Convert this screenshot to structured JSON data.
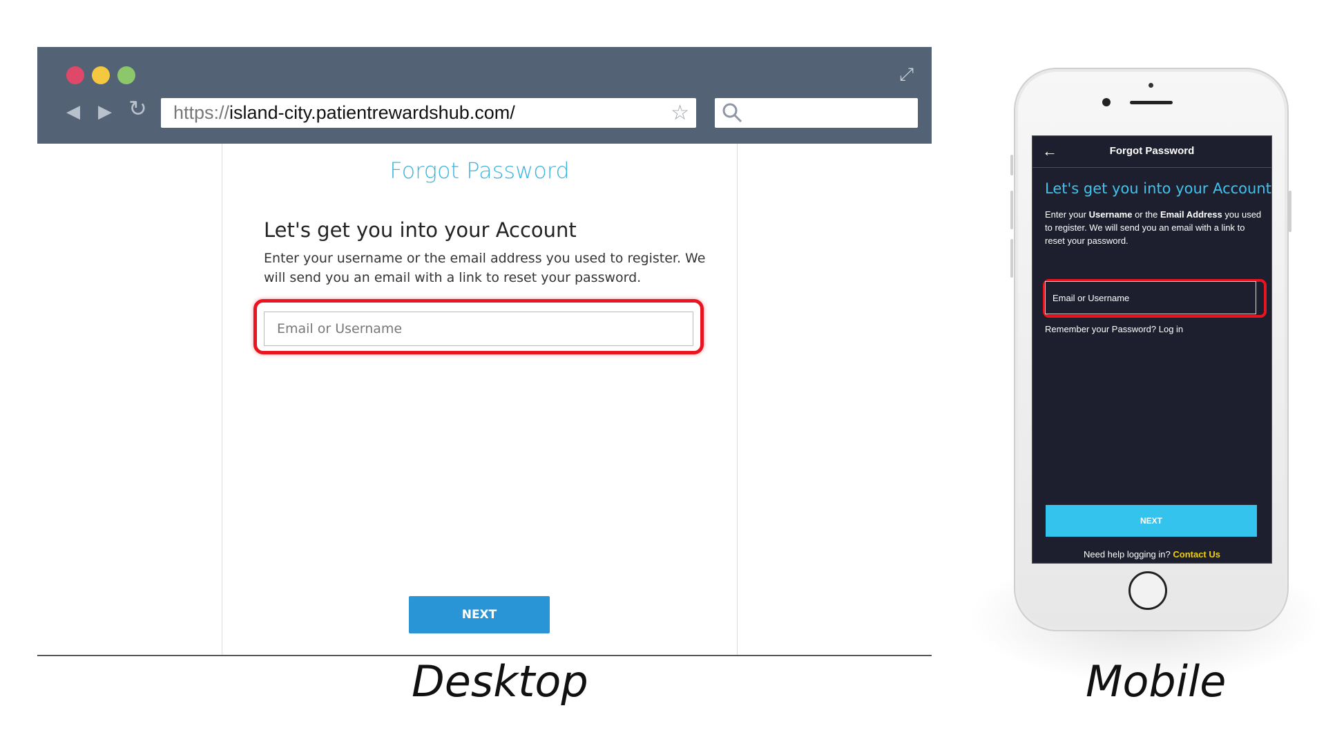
{
  "browser": {
    "url_protocol": "https://",
    "url_host": "island-city.patientrewardshub.com/",
    "icons": [
      "back-icon",
      "forward-icon",
      "reload-icon",
      "star-icon",
      "search-icon",
      "expand-icon"
    ]
  },
  "desktop": {
    "title": "Forgot Password",
    "heading": "Let's get you into your Account",
    "description": "Enter your username or the email address you used to register. We will send you an email with a link to reset your password.",
    "input_placeholder": "Email or Username",
    "next_label": "NEXT",
    "caption": "Desktop"
  },
  "mobile": {
    "header_title": "Forgot Password",
    "heading": "Let's get you into your Account",
    "desc_1": "Enter your ",
    "desc_bold_1": "Username",
    "desc_2": " or the ",
    "desc_bold_2": "Email Address",
    "desc_3": " you used to register. We will send you an email with a link to reset your password.",
    "input_placeholder": "Email or Username",
    "remember_text": "Remember your Password? Log in",
    "next_label": "NEXT",
    "help_text": "Need help logging in? ",
    "contact_label": "Contact Us",
    "caption": "Mobile"
  },
  "colors": {
    "browser_chrome": "#546275",
    "accent_blue": "#3ab6e0",
    "desktop_button": "#2a95d6",
    "mobile_bg": "#1e1f2e",
    "mobile_button": "#33c3ec",
    "highlight_red": "#e8141f",
    "contact_yellow": "#f2d200"
  }
}
